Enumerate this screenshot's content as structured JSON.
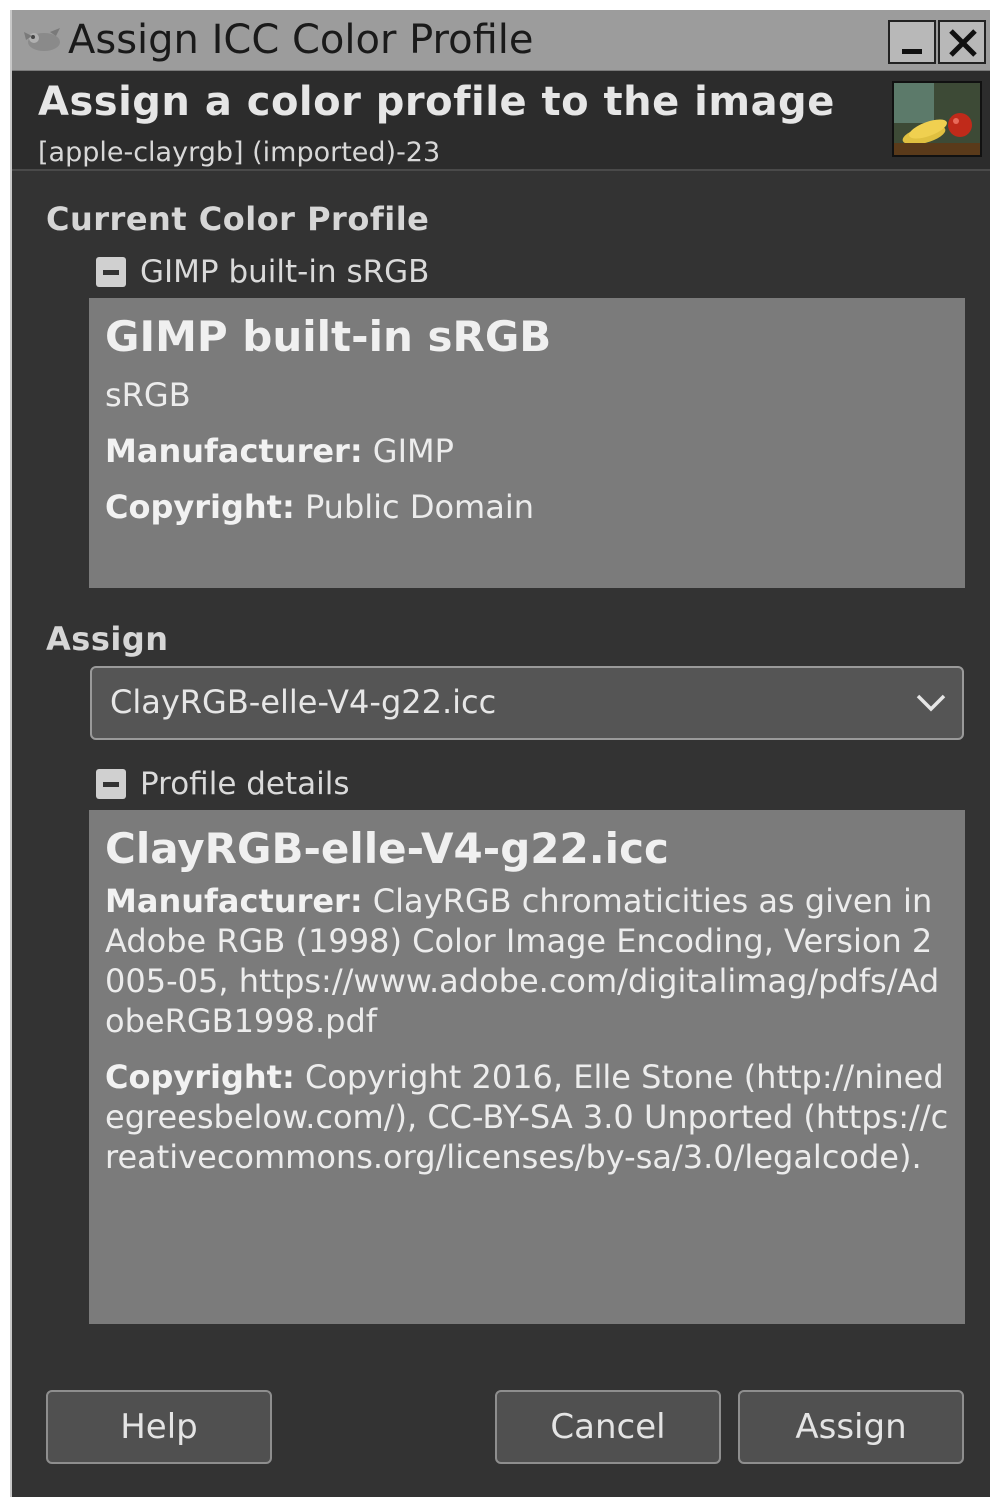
{
  "window": {
    "title": "Assign ICC Color Profile"
  },
  "header": {
    "title": "Assign a color profile to the image",
    "subtitle": "[apple-clayrgb] (imported)-23"
  },
  "current": {
    "section_label": "Current Color Profile",
    "expander_label": "GIMP built-in sRGB",
    "profile_name": "GIMP built-in sRGB",
    "description": "sRGB",
    "manufacturer_key": "Manufacturer:",
    "manufacturer_value": "GIMP",
    "copyright_key": "Copyright:",
    "copyright_value": "Public Domain"
  },
  "assign": {
    "section_label": "Assign",
    "selected_profile": "ClayRGB-elle-V4-g22.icc",
    "expander_label": "Profile details",
    "profile_name": "ClayRGB-elle-V4-g22.icc",
    "manufacturer_key": "Manufacturer:",
    "manufacturer_value": "ClayRGB chromaticities as given in Adobe RGB (1998) Color Image Encoding, Version 2005-05, https://www.adobe.com/digitalimag/pdfs/AdobeRGB1998.pdf",
    "copyright_key": "Copyright:",
    "copyright_value": "Copyright 2016, Elle Stone (http://ninedegreesbelow.com/), CC-BY-SA 3.0 Unported (https://creativecommons.org/licenses/by-sa/3.0/legalcode)."
  },
  "buttons": {
    "help": "Help",
    "cancel": "Cancel",
    "assign": "Assign"
  },
  "icons": {
    "app": "gimp-wilber-icon",
    "minimize": "minimize-icon",
    "close": "close-icon",
    "dropdown": "chevron-down-icon",
    "collapse": "collapse-minus-icon"
  },
  "colors": {
    "background": "#333333",
    "panel": "#7b7b7b",
    "titlebar": "#9c9c9c"
  }
}
